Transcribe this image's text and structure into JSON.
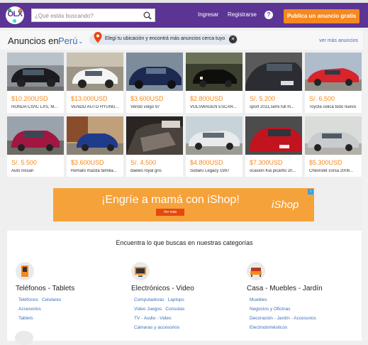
{
  "header": {
    "logo": "OLX",
    "search_placeholder": "¿Qué estás buscando?",
    "login_label": "Ingresar",
    "register_label": "Registrarse",
    "help_label": "?",
    "post_ad_label": "Publica un anuncio gratis"
  },
  "ads_bar": {
    "title": "Anuncios en",
    "country": "Perú",
    "location_prompt": "Elegí tu ubicación y encontrá más anuncios cerca tuyo",
    "see_more": "ver más anuncios"
  },
  "listings": [
    {
      "price": "$10.200USD",
      "desc": "HONDA CIVIC LXS, M..."
    },
    {
      "price": "$13.000USD",
      "desc": "VENDO AUTO HYUNG..."
    },
    {
      "price": "$3.600USD",
      "desc": "Vendo volgo 97"
    },
    {
      "price": "$2.800USD",
      "desc": "VOLSWAGEN ESCAR..."
    },
    {
      "price": "S/. 5.200",
      "desc": "sport 2011,semi full m..."
    },
    {
      "price": "S/. 6.500",
      "desc": "Toyota celica todo nuevo"
    },
    {
      "price": "S/. 5.500",
      "desc": "Auto nissan"
    },
    {
      "price": "$3.600USD",
      "desc": "Remato mazda familia..."
    },
    {
      "price": "S/. 4.500",
      "desc": "daewo royal gris"
    },
    {
      "price": "$4.800USD",
      "desc": "Subaru Legacy 1997"
    },
    {
      "price": "$7.300USD",
      "desc": "ocasion Kia picanto 20..."
    },
    {
      "price": "$5.300USD",
      "desc": "Chevrolet corsa 2006..."
    }
  ],
  "banner": {
    "text": "¡Engríe a mamá con iShop!",
    "button": "Ver más",
    "brand": "iShop"
  },
  "categories": {
    "heading": "Encuentra lo que buscas en nuestras categorías",
    "columns": [
      {
        "title": "Teléfonos - Tablets",
        "icon": "phone-icon",
        "rows": [
          [
            "Teléfonos",
            "Celulares"
          ],
          [
            "Accesorios"
          ],
          [
            "Tablets"
          ]
        ]
      },
      {
        "title": "Electrónicos - Video",
        "icon": "tv-icon",
        "rows": [
          [
            "Computadoras",
            "Laptops"
          ],
          [
            "Video Juegos",
            "Consolas"
          ],
          [
            "TV - Audio - Video"
          ],
          [
            "Cámaras y accesorios"
          ]
        ]
      },
      {
        "title": "Casa - Muebles - Jardín",
        "icon": "sofa-icon",
        "rows": [
          [
            "Muebles"
          ],
          [
            "Negocios y Oficinas"
          ],
          [
            "Decoración - Jardín - Accesorios"
          ],
          [
            "Electrodomésticos"
          ]
        ]
      }
    ]
  },
  "colors": {
    "header": "#5b3494",
    "accent": "#f5881f",
    "link": "#3d71b8"
  }
}
